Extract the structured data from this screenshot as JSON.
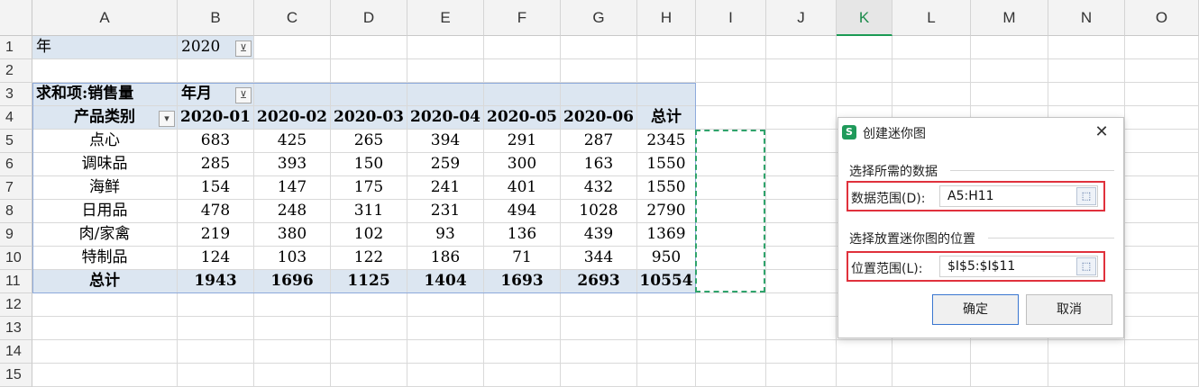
{
  "columns": [
    "A",
    "B",
    "C",
    "D",
    "E",
    "F",
    "G",
    "H",
    "I",
    "J",
    "K",
    "L",
    "M",
    "N",
    "O"
  ],
  "selected_column": "K",
  "rows": [
    "1",
    "2",
    "3",
    "4",
    "5",
    "6",
    "7",
    "8",
    "9",
    "10",
    "11",
    "12",
    "13",
    "14",
    "15"
  ],
  "filter": {
    "label": "年",
    "value": "2020"
  },
  "pivot": {
    "corner_label": "求和项:销售量",
    "col_field": "年月",
    "row_field": "产品类别",
    "month_headers": [
      "2020-01",
      "2020-02",
      "2020-03",
      "2020-04",
      "2020-05",
      "2020-06"
    ],
    "total_header": "总计",
    "body": [
      {
        "category": "点心",
        "values": [
          "683",
          "425",
          "265",
          "394",
          "291",
          "287"
        ],
        "total": "2345"
      },
      {
        "category": "调味品",
        "values": [
          "285",
          "393",
          "150",
          "259",
          "300",
          "163"
        ],
        "total": "1550"
      },
      {
        "category": "海鲜",
        "values": [
          "154",
          "147",
          "175",
          "241",
          "401",
          "432"
        ],
        "total": "1550"
      },
      {
        "category": "日用品",
        "values": [
          "478",
          "248",
          "311",
          "231",
          "494",
          "1028"
        ],
        "total": "2790"
      },
      {
        "category": "肉/家禽",
        "values": [
          "219",
          "380",
          "102",
          "93",
          "136",
          "439"
        ],
        "total": "1369"
      },
      {
        "category": "特制品",
        "values": [
          "124",
          "103",
          "122",
          "186",
          "71",
          "344"
        ],
        "total": "950"
      }
    ],
    "grand_total": {
      "label": "总计",
      "values": [
        "1943",
        "1696",
        "1125",
        "1404",
        "1693",
        "2693"
      ],
      "total": "10554"
    }
  },
  "dialog": {
    "title": "创建迷你图",
    "logo": "S",
    "close_icon": "close-icon",
    "section1": "选择所需的数据",
    "data_range_label": "数据范围(D):",
    "data_range_value": "A5:H11",
    "section2": "选择放置迷你图的位置",
    "location_range_label": "位置范围(L):",
    "location_range_value": "$I$5:$I$11",
    "ok_label": "确定",
    "cancel_label": "取消"
  },
  "colors": {
    "header_fill": "#dce6f1",
    "selection_dash": "#2fa36b",
    "highlight_box": "#e0313c",
    "primary_border": "#3a76d0"
  }
}
